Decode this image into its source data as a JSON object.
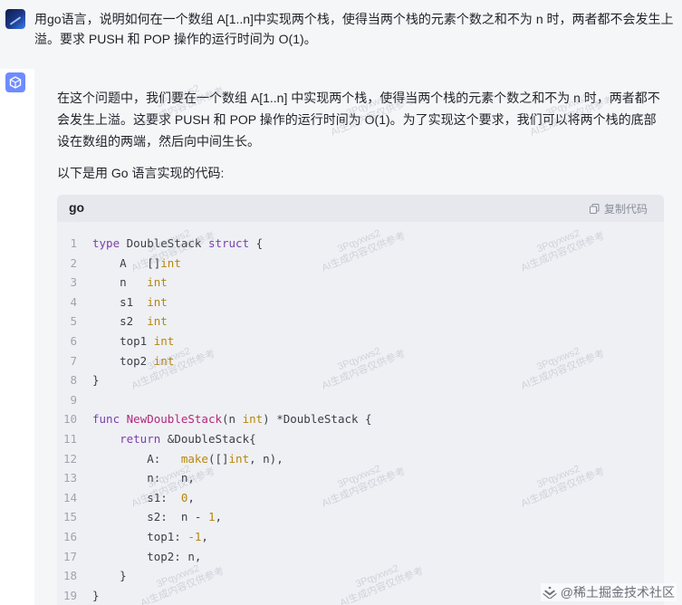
{
  "user_message": {
    "text": "用go语言，说明如何在一个数组 A[1..n]中实现两个栈，使得当两个栈的元素个数之和不为 n 时，两者都不会发生上溢。要求 PUSH 和 POP 操作的运行时间为 O(1)。"
  },
  "ai_message": {
    "paragraph": "在这个问题中，我们要在一个数组 A[1..n] 中实现两个栈，使得当两个栈的元素个数之和不为 n 时，两者都不会发生上溢。这要求 PUSH 和 POP 操作的运行时间为 O(1)。为了实现这个要求，我们可以将两个栈的底部设在数组的两端，然后向中间生长。",
    "subheading": "以下是用 Go 语言实现的代码:"
  },
  "code": {
    "language": "go",
    "copy_label": "复制代码",
    "line_numbers": [
      "1",
      "2",
      "3",
      "4",
      "5",
      "6",
      "7",
      "8",
      "9",
      "10",
      "11",
      "12",
      "13",
      "14",
      "15",
      "16",
      "17",
      "18",
      "19"
    ]
  },
  "watermark": {
    "handle": "3Pqyxws2",
    "note": "AI生成内容仅供参考",
    "footer": "@稀土掘金技术社区"
  },
  "colors": {
    "keyword": "#7b3fa8",
    "type": "#b8860b",
    "function": "#b4287a",
    "panel_bg": "#f5f6f8",
    "code_bg": "#eef0f4"
  },
  "icons": {
    "copy": "copy-icon",
    "ai_avatar": "cube-icon",
    "footer_logo": "juejin-logo-icon"
  }
}
